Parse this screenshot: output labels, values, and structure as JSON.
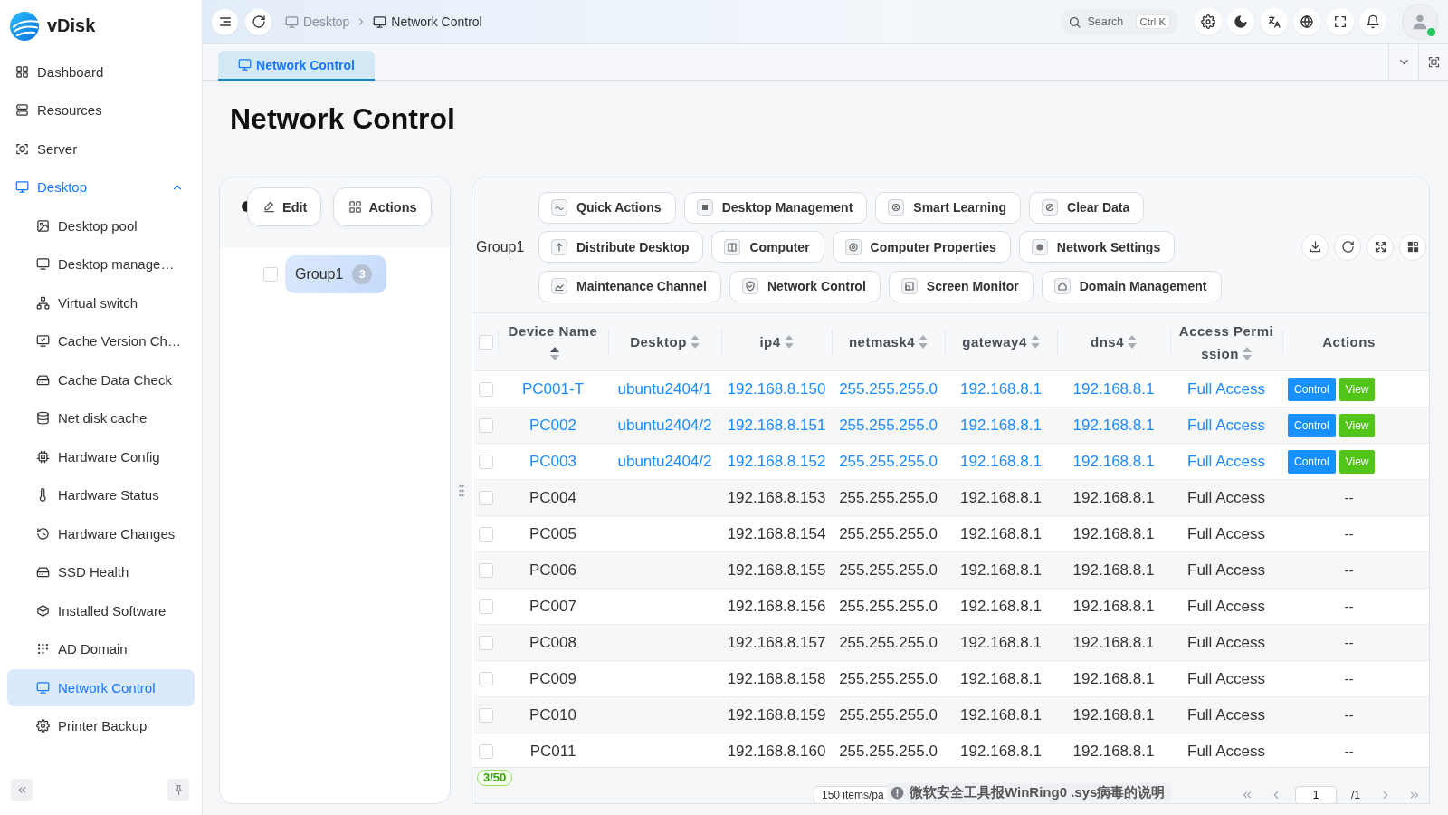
{
  "sidebar": {
    "logo": "vDisk",
    "items": [
      {
        "label": "Dashboard",
        "selected": false
      },
      {
        "label": "Resources",
        "selected": false
      },
      {
        "label": "Server",
        "selected": false
      },
      {
        "label": "Desktop",
        "selected": false,
        "expanded": true,
        "children": [
          {
            "label": "Desktop pool",
            "selected": false
          },
          {
            "label": "Desktop manage…",
            "selected": false
          },
          {
            "label": "Virtual switch",
            "selected": false
          },
          {
            "label": "Cache Version Ch…",
            "selected": false
          },
          {
            "label": "Cache Data Check",
            "selected": false
          },
          {
            "label": "Net disk cache",
            "selected": false
          },
          {
            "label": "Hardware Config",
            "selected": false
          },
          {
            "label": "Hardware Status",
            "selected": false
          },
          {
            "label": "Hardware Changes",
            "selected": false
          },
          {
            "label": "SSD Health",
            "selected": false
          },
          {
            "label": "Installed Software",
            "selected": false
          },
          {
            "label": "AD Domain",
            "selected": false
          },
          {
            "label": "Network Control",
            "selected": true
          },
          {
            "label": "Printer Backup",
            "selected": false
          }
        ]
      }
    ]
  },
  "header": {
    "breadcrumb": [
      {
        "label": "Desktop"
      },
      {
        "label": "Network Control"
      }
    ],
    "search": {
      "placeholder": "Search",
      "shortcut": "Ctrl K"
    },
    "user": {
      "online": true
    }
  },
  "tabs": [
    {
      "label": "Network Control",
      "selected": true
    }
  ],
  "page_title": "Network Control",
  "group_panel": {
    "buttons": [
      {
        "label": "Edit"
      },
      {
        "label": "Actions"
      }
    ],
    "tree": [
      {
        "label": "Group1",
        "count": "3",
        "selected": true,
        "checked": false
      }
    ]
  },
  "toolbar": {
    "group_label": "Group1",
    "action_rows": [
      {
        "buttons": [
          {
            "label": "Quick Actions"
          },
          {
            "label": "Desktop Management"
          },
          {
            "label": "Smart Learning"
          },
          {
            "label": "Clear Data"
          }
        ]
      },
      {
        "buttons": [
          {
            "label": "Distribute Desktop"
          },
          {
            "label": "Computer"
          },
          {
            "label": "Computer Properties"
          },
          {
            "label": "Network Settings"
          }
        ]
      },
      {
        "buttons": [
          {
            "label": "Maintenance Channel"
          },
          {
            "label": "Network Control"
          },
          {
            "label": "Screen Monitor"
          },
          {
            "label": "Domain Management"
          }
        ]
      }
    ]
  },
  "table": {
    "select_all_checked": false,
    "columns": [
      {
        "label": "Device Name",
        "sortable": true,
        "sorted": true
      },
      {
        "label": "Desktop",
        "sortable": true,
        "sorted": false
      },
      {
        "label": "ip4",
        "sortable": true,
        "sorted": false
      },
      {
        "label": "netmask4",
        "sortable": true,
        "sorted": false
      },
      {
        "label": "gateway4",
        "sortable": true,
        "sorted": false
      },
      {
        "label": "dns4",
        "sortable": true,
        "sorted": false
      },
      {
        "label": "Access Permission",
        "sortable": true,
        "sorted": false
      },
      {
        "label": "Actions",
        "sortable": false
      }
    ],
    "rows": [
      {
        "checked": false,
        "online": true,
        "device_name": "PC001-T",
        "desktop": "ubuntu2404/1",
        "ip4": "192.168.8.150",
        "netmask4": "255.255.255.0",
        "gateway4": "192.168.8.1",
        "dns4": "192.168.8.1",
        "access_permission": "Full Access",
        "actions": [
          {
            "label": "Control",
            "kind": "primary"
          },
          {
            "label": "View",
            "kind": "success"
          }
        ]
      },
      {
        "checked": false,
        "online": true,
        "device_name": "PC002",
        "desktop": "ubuntu2404/2",
        "ip4": "192.168.8.151",
        "netmask4": "255.255.255.0",
        "gateway4": "192.168.8.1",
        "dns4": "192.168.8.1",
        "access_permission": "Full Access",
        "actions": [
          {
            "label": "Control",
            "kind": "primary"
          },
          {
            "label": "View",
            "kind": "success"
          }
        ]
      },
      {
        "checked": false,
        "online": true,
        "device_name": "PC003",
        "desktop": "ubuntu2404/2",
        "ip4": "192.168.8.152",
        "netmask4": "255.255.255.0",
        "gateway4": "192.168.8.1",
        "dns4": "192.168.8.1",
        "access_permission": "Full Access",
        "actions": [
          {
            "label": "Control",
            "kind": "primary"
          },
          {
            "label": "View",
            "kind": "success"
          }
        ]
      },
      {
        "checked": false,
        "online": false,
        "device_name": "PC004",
        "ip4": "192.168.8.153",
        "netmask4": "255.255.255.0",
        "gateway4": "192.168.8.1",
        "dns4": "192.168.8.1",
        "access_permission": "Full Access",
        "actions_empty": "--"
      },
      {
        "checked": false,
        "online": false,
        "device_name": "PC005",
        "ip4": "192.168.8.154",
        "netmask4": "255.255.255.0",
        "gateway4": "192.168.8.1",
        "dns4": "192.168.8.1",
        "access_permission": "Full Access",
        "actions_empty": "--"
      },
      {
        "checked": false,
        "online": false,
        "device_name": "PC006",
        "ip4": "192.168.8.155",
        "netmask4": "255.255.255.0",
        "gateway4": "192.168.8.1",
        "dns4": "192.168.8.1",
        "access_permission": "Full Access",
        "actions_empty": "--"
      },
      {
        "checked": false,
        "online": false,
        "device_name": "PC007",
        "ip4": "192.168.8.156",
        "netmask4": "255.255.255.0",
        "gateway4": "192.168.8.1",
        "dns4": "192.168.8.1",
        "access_permission": "Full Access",
        "actions_empty": "--"
      },
      {
        "checked": false,
        "online": false,
        "device_name": "PC008",
        "ip4": "192.168.8.157",
        "netmask4": "255.255.255.0",
        "gateway4": "192.168.8.1",
        "dns4": "192.168.8.1",
        "access_permission": "Full Access",
        "actions_empty": "--"
      },
      {
        "checked": false,
        "online": false,
        "device_name": "PC009",
        "ip4": "192.168.8.158",
        "netmask4": "255.255.255.0",
        "gateway4": "192.168.8.1",
        "dns4": "192.168.8.1",
        "access_permission": "Full Access",
        "actions_empty": "--"
      },
      {
        "checked": false,
        "online": false,
        "device_name": "PC010",
        "ip4": "192.168.8.159",
        "netmask4": "255.255.255.0",
        "gateway4": "192.168.8.1",
        "dns4": "192.168.8.1",
        "access_permission": "Full Access",
        "actions_empty": "--"
      },
      {
        "checked": false,
        "online": false,
        "device_name": "PC011",
        "ip4": "192.168.8.160",
        "netmask4": "255.255.255.0",
        "gateway4": "192.168.8.1",
        "dns4": "192.168.8.1",
        "access_permission": "Full Access",
        "actions_empty": "--"
      }
    ]
  },
  "footer": {
    "selection_count": "3/50",
    "page_size": "150 items/pa",
    "page": "1",
    "total_pages": "/1"
  },
  "notice": {
    "text": "微软安全工具报WinRing0 .sys病毒的说明"
  }
}
